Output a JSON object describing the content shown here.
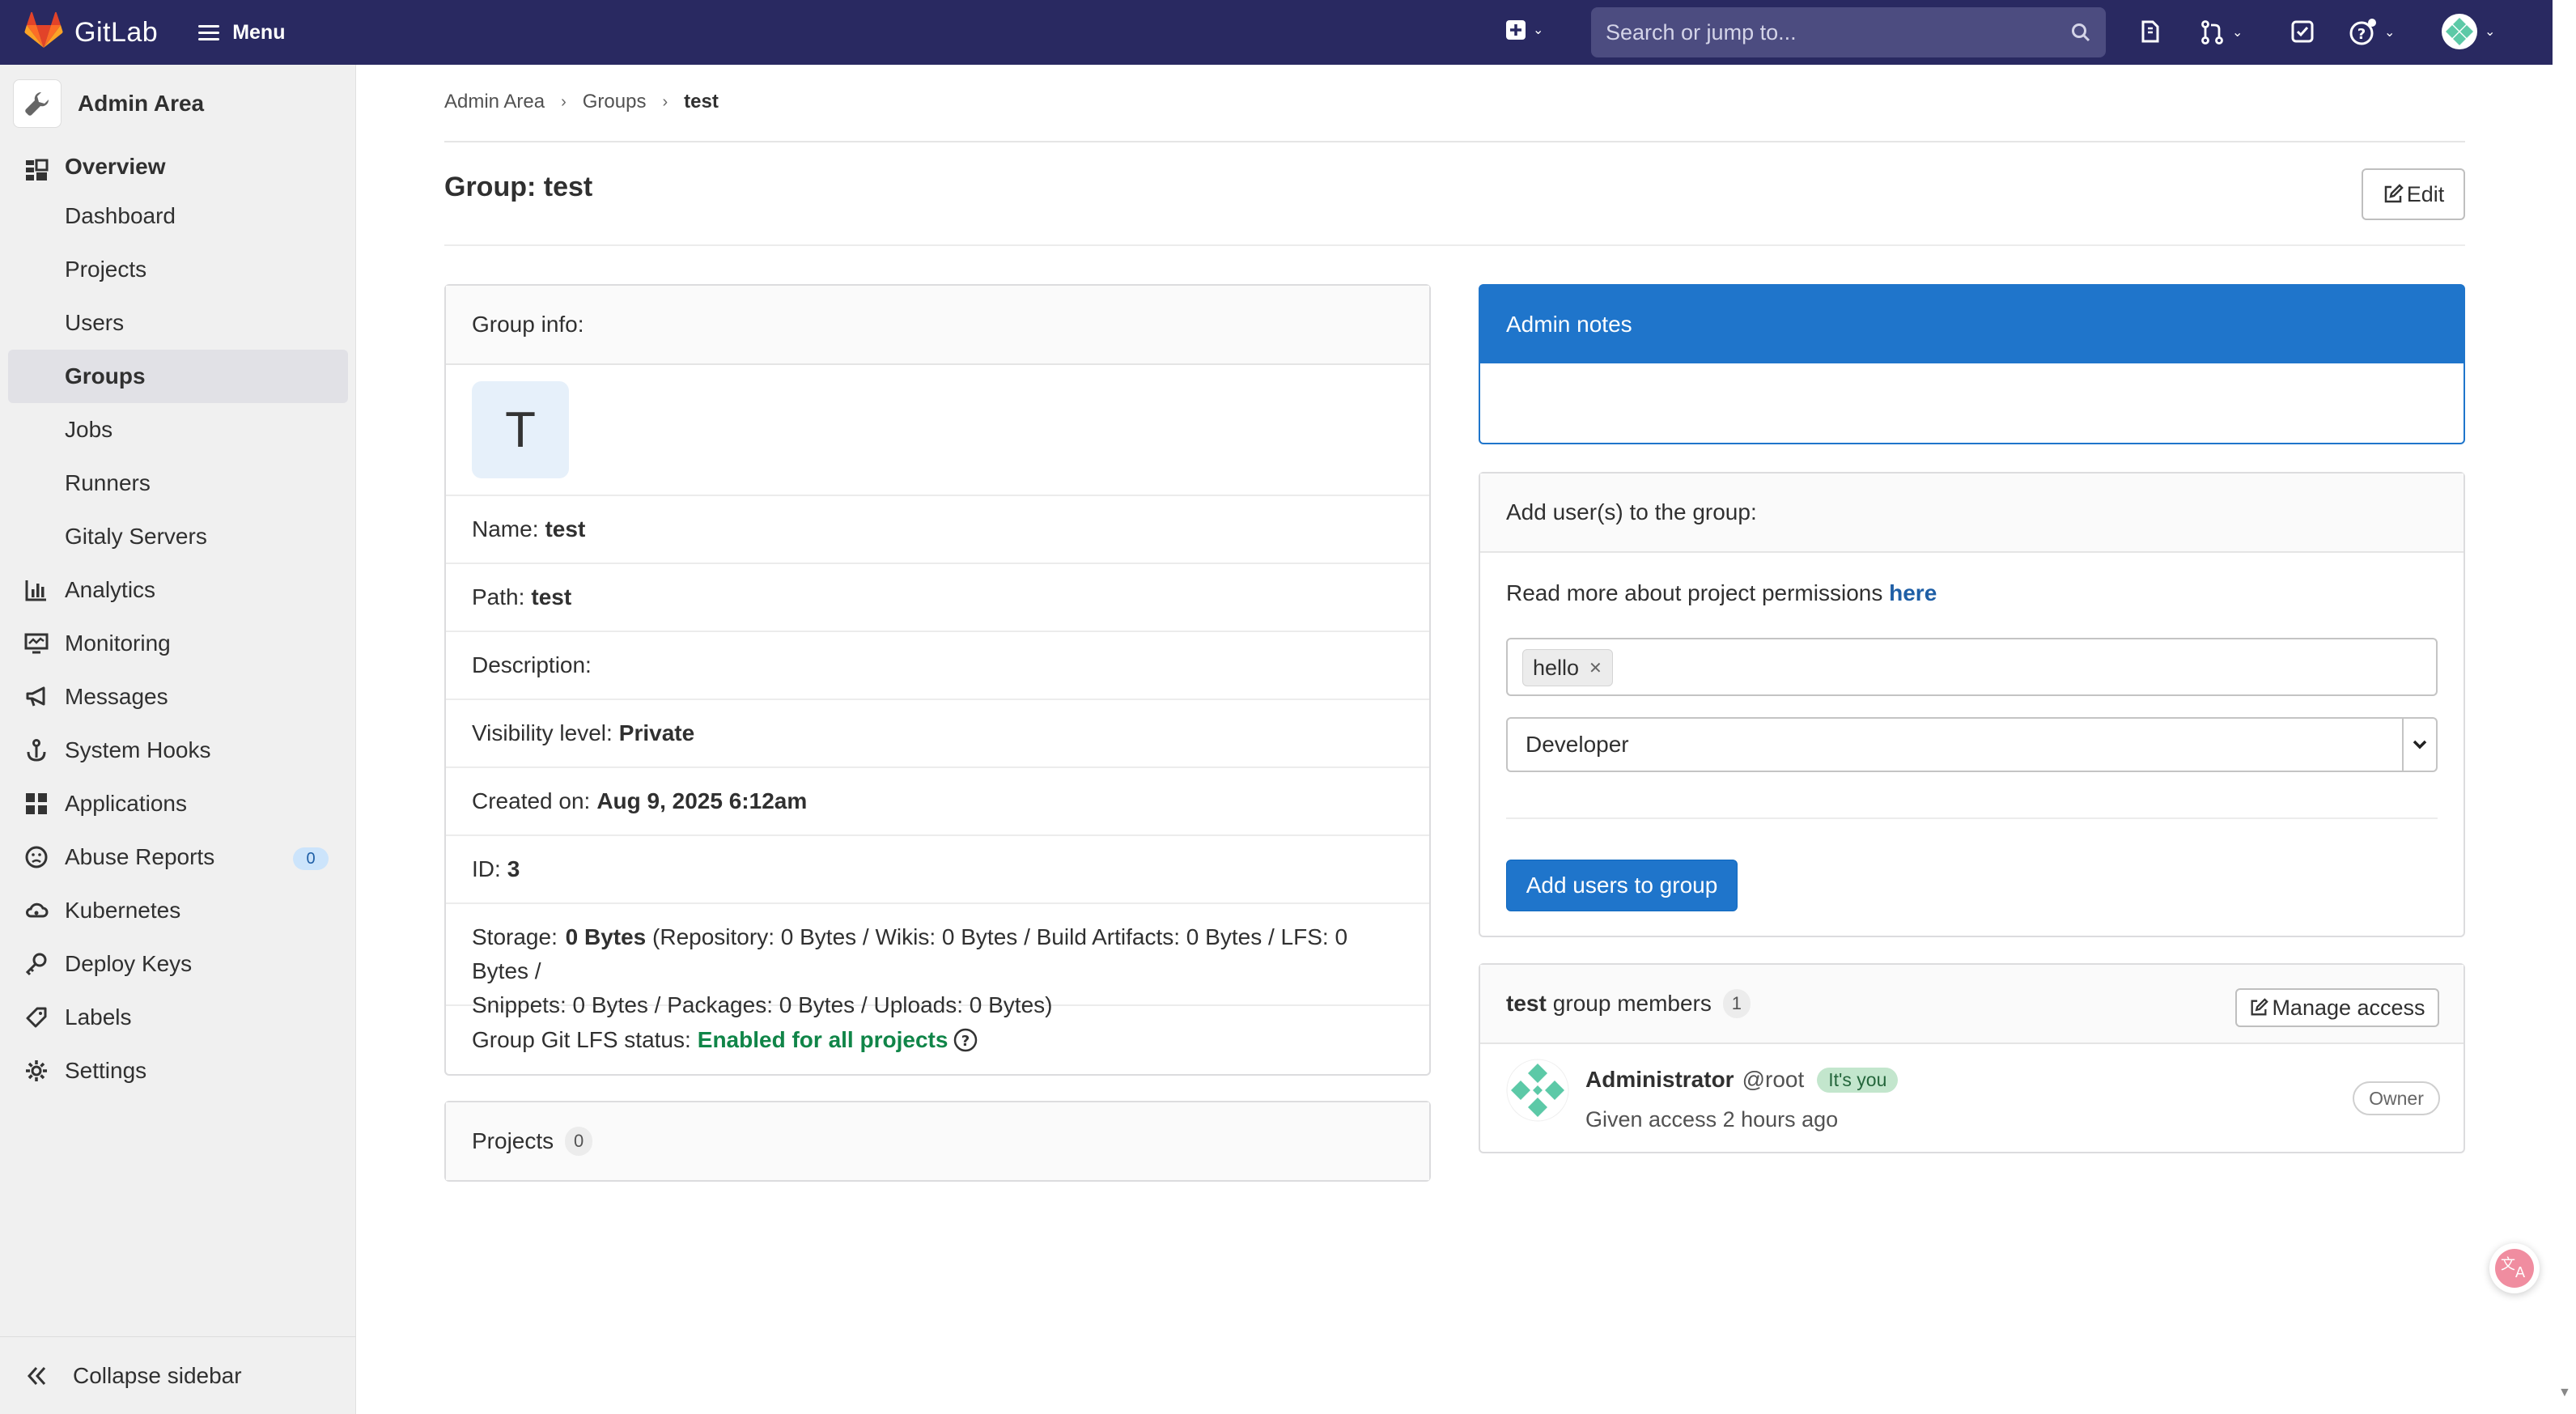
{
  "navbar": {
    "brand": "GitLab",
    "menu_label": "Menu",
    "search_placeholder": "Search or jump to...",
    "icons": [
      "plus-square-icon",
      "search-icon",
      "issues-icon",
      "merge-request-icon",
      "todo-icon",
      "help-icon",
      "user-avatar-icon"
    ]
  },
  "sidebar": {
    "title": "Admin Area",
    "items": [
      {
        "label": "Overview",
        "icon": "overview-icon",
        "parent": true
      },
      {
        "label": "Dashboard"
      },
      {
        "label": "Projects"
      },
      {
        "label": "Users"
      },
      {
        "label": "Groups",
        "active": true
      },
      {
        "label": "Jobs"
      },
      {
        "label": "Runners"
      },
      {
        "label": "Gitaly Servers"
      },
      {
        "label": "Analytics",
        "icon": "chart-icon"
      },
      {
        "label": "Monitoring",
        "icon": "monitor-icon"
      },
      {
        "label": "Messages",
        "icon": "bullhorn-icon"
      },
      {
        "label": "System Hooks",
        "icon": "hook-icon"
      },
      {
        "label": "Applications",
        "icon": "applications-icon"
      },
      {
        "label": "Abuse Reports",
        "icon": "slight-frown-icon",
        "badge": "0"
      },
      {
        "label": "Kubernetes",
        "icon": "cloud-gear-icon"
      },
      {
        "label": "Deploy Keys",
        "icon": "key-icon"
      },
      {
        "label": "Labels",
        "icon": "label-icon"
      },
      {
        "label": "Settings",
        "icon": "settings-icon"
      }
    ],
    "collapse_label": "Collapse sidebar"
  },
  "breadcrumb": [
    "Admin Area",
    "Groups",
    "test"
  ],
  "page": {
    "title": "Group: test",
    "edit_label": "Edit"
  },
  "group_info": {
    "header": "Group info:",
    "avatar_letter": "T",
    "name_label": "Name:",
    "name_value": "test",
    "path_label": "Path:",
    "path_value": "test",
    "description_label": "Description:",
    "visibility_label": "Visibility level:",
    "visibility_value": "Private",
    "created_label": "Created on:",
    "created_value": "Aug 9, 2025 6:12am",
    "id_label": "ID:",
    "id_value": "3",
    "storage_label": "Storage:",
    "storage_value": "0 Bytes",
    "storage_detail_line1": "(Repository: 0 Bytes / Wikis: 0 Bytes / Build Artifacts: 0 Bytes / LFS: 0 Bytes /",
    "storage_detail_line2": "Snippets: 0 Bytes / Packages: 0 Bytes / Uploads: 0 Bytes)",
    "lfs_label": "Group Git LFS status:",
    "lfs_value": "Enabled for all projects"
  },
  "projects_card": {
    "label": "Projects",
    "count": "0"
  },
  "admin_notes": {
    "header": "Admin notes"
  },
  "add_users": {
    "header": "Add user(s) to the group:",
    "permissions_text": "Read more about project permissions",
    "permissions_link": "here",
    "selected_user": "hello",
    "role_value": "Developer",
    "submit_label": "Add users to group"
  },
  "members": {
    "group_name": "test",
    "label": "group members",
    "count": "1",
    "manage_label": "Manage access",
    "list": [
      {
        "name": "Administrator",
        "username": "@root",
        "tag": "It's you",
        "access_text": "Given access 2 hours ago",
        "role": "Owner"
      }
    ]
  },
  "colors": {
    "navbar": "#292961",
    "accent": "#1f75cb",
    "success": "#108548",
    "sidebar_bg": "#f0f0f0"
  }
}
